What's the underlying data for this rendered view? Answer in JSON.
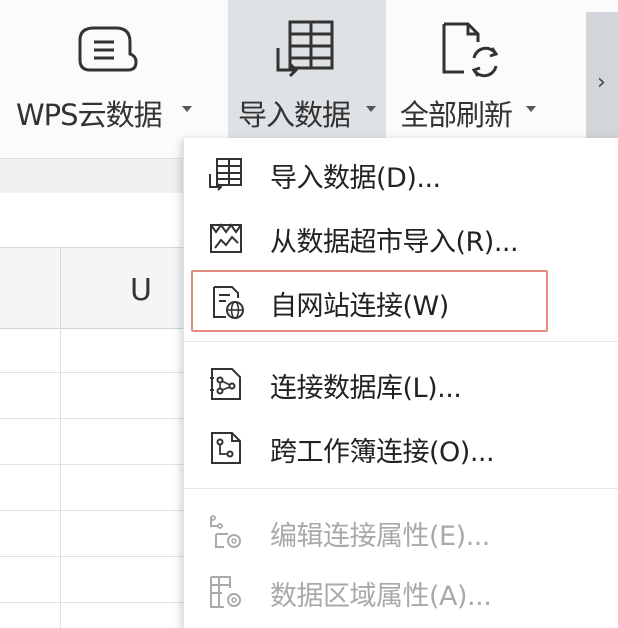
{
  "ribbon": {
    "wps_cloud_label": "WPS云数据",
    "import_label": "导入数据",
    "refresh_label": "全部刷新",
    "more_glyph": "›"
  },
  "sheet": {
    "column_label": "U"
  },
  "menu": {
    "items": [
      {
        "label": "导入数据(D)..."
      },
      {
        "label": "从数据超市导入(R)..."
      },
      {
        "label": "自网站连接(W)"
      },
      {
        "label": "连接数据库(L)..."
      },
      {
        "label": "跨工作簿连接(O)..."
      },
      {
        "label": "编辑连接属性(E)..."
      },
      {
        "label": "数据区域属性(A)..."
      }
    ]
  },
  "colors": {
    "highlight_border": "#e38b7f",
    "disabled_text": "#a9a9a9"
  }
}
